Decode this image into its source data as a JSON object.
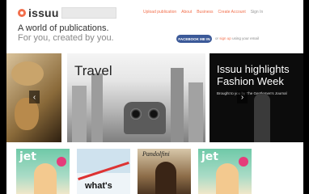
{
  "header": {
    "logo_text": "issuu",
    "nav": [
      "Upload publication",
      "About",
      "Business",
      "Create Account",
      "Sign In"
    ]
  },
  "hero": {
    "tagline_line1": "A world of publications.",
    "tagline_line2": "For you, created by you.",
    "facebook_button": "FACEBOOK ME IN",
    "alt_signup_prefix": "or",
    "alt_signup_link": "sign up",
    "alt_signup_suffix": "using your email"
  },
  "carousel": {
    "slides": [
      {
        "title": ""
      },
      {
        "title": "Travel"
      },
      {
        "title": "Issuu highlights Fashion Week",
        "subtitle": "Brought to you by The Gentlemen's Journal"
      }
    ],
    "prev": "‹",
    "next": "›"
  },
  "publications": [
    {
      "title": "jet"
    },
    {
      "title": "what's"
    },
    {
      "title": "Pandolfini"
    },
    {
      "title": "jet"
    }
  ],
  "colors": {
    "brand": "#f26f4c",
    "facebook": "#3b5998"
  }
}
